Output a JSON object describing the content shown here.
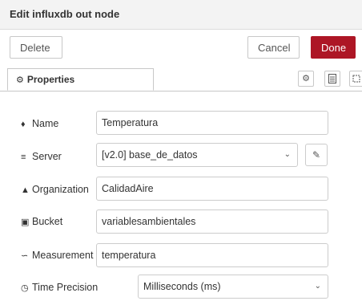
{
  "header": {
    "title": "Edit influxdb out node"
  },
  "toolbar": {
    "delete_label": "Delete",
    "cancel_label": "Cancel",
    "done_label": "Done"
  },
  "tabs": {
    "properties_label": "Properties"
  },
  "form": {
    "name": {
      "label": "Name",
      "value": "Temperatura"
    },
    "server": {
      "label": "Server",
      "value": "[v2.0] base_de_datos"
    },
    "organization": {
      "label": "Organization",
      "value": "CalidadAire"
    },
    "bucket": {
      "label": "Bucket",
      "value": "variablesambientales"
    },
    "measurement": {
      "label": "Measurement",
      "value": "temperatura"
    },
    "time_precision": {
      "label": "Time Precision",
      "value": "Milliseconds (ms)"
    }
  },
  "icons": {
    "properties": "gear-icon",
    "name": "tag-icon",
    "server": "server-icon",
    "organization": "sitemap-icon",
    "bucket": "database-icon",
    "measurement": "rss-icon",
    "time_precision": "clock-icon",
    "edit": "pencil-icon"
  },
  "colors": {
    "done": "#ad1625",
    "header_bg": "#f3f3f3"
  }
}
